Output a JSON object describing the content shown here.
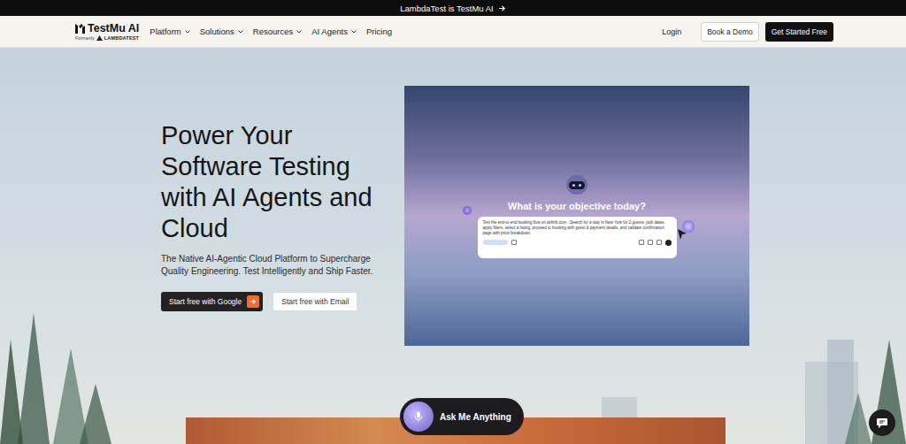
{
  "banner": {
    "text": "LambdaTest is TestMu AI"
  },
  "logo": {
    "name": "TestMu AI",
    "formerly": "Formerly",
    "former_brand": "LAMBDATEST"
  },
  "nav": {
    "items": [
      {
        "label": "Platform",
        "dropdown": true
      },
      {
        "label": "Solutions",
        "dropdown": true
      },
      {
        "label": "Resources",
        "dropdown": true
      },
      {
        "label": "AI Agents",
        "dropdown": true
      },
      {
        "label": "Pricing",
        "dropdown": false
      }
    ],
    "login": "Login",
    "demo": "Book a Demo",
    "cta": "Get Started Free"
  },
  "hero": {
    "heading_lines": [
      "Power Your",
      "Software Testing",
      "with AI Agents and",
      "Cloud"
    ],
    "subtitle_lines": [
      "The Native AI-Agentic Cloud Platform to Supercharge",
      "Quality Engineering. Test Intelligently and Ship Faster."
    ],
    "buttons": [
      {
        "label": "Start free with Google",
        "kind": "primary"
      },
      {
        "label": "Start free with Email",
        "kind": "secondary"
      }
    ]
  },
  "demo": {
    "prompt": "What is your objective today?",
    "input": "Test the end-to-end booking flow on airbnb.com : Search for a stay in New York for 2 guests, pick dates, apply filters, select a listing, proceed to booking with guest & payment details, and validate confirmation page with price breakdown."
  },
  "assistant": {
    "label": "Ask Me Anything"
  }
}
